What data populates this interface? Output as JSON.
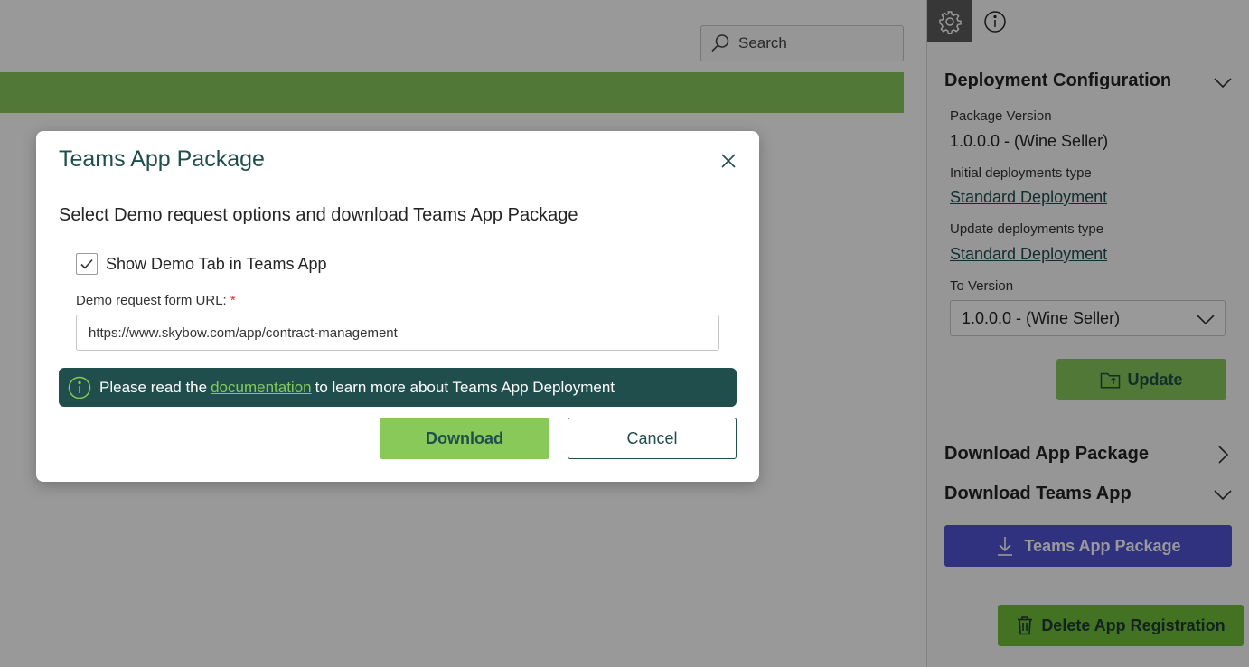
{
  "search": {
    "placeholder": "Search"
  },
  "side_panel": {
    "tabs": [
      {
        "icon": "gear-icon",
        "active": true
      },
      {
        "icon": "info-icon",
        "active": false
      }
    ],
    "deployment_configuration": {
      "title": "Deployment Configuration",
      "package_version_label": "Package Version",
      "package_version_value": "1.0.0.0 - (Wine Seller)",
      "initial_type_label": "Initial deployments type",
      "initial_type_value": "Standard Deployment",
      "update_type_label": "Update deployments type",
      "update_type_value": "Standard Deployment",
      "to_version_label": "To Version",
      "to_version_value": "1.0.0.0 - (Wine Seller)",
      "update_button": "Update"
    },
    "download_app_package": {
      "title": "Download App Package"
    },
    "download_teams_app": {
      "title": "Download Teams App",
      "teams_app_package_button": "Teams App Package"
    },
    "delete_button": "Delete App Registration"
  },
  "dialog": {
    "title": "Teams App Package",
    "subtitle": "Select Demo request options and download Teams App Package",
    "checkbox_label": "Show Demo Tab in Teams App",
    "checkbox_checked": true,
    "url_label": "Demo request form URL:",
    "url_required_mark": "*",
    "url_value": "https://www.skybow.com/app/contract-management",
    "info_prefix": "Please read the",
    "info_link": "documentation",
    "info_suffix": "to learn more about Teams App Deployment",
    "download_button": "Download",
    "cancel_button": "Cancel"
  },
  "colors": {
    "brand_green": "#88c95a",
    "dark_teal": "#1f4e4c",
    "teams_purple": "#5254d4",
    "required_red": "#d13438"
  }
}
